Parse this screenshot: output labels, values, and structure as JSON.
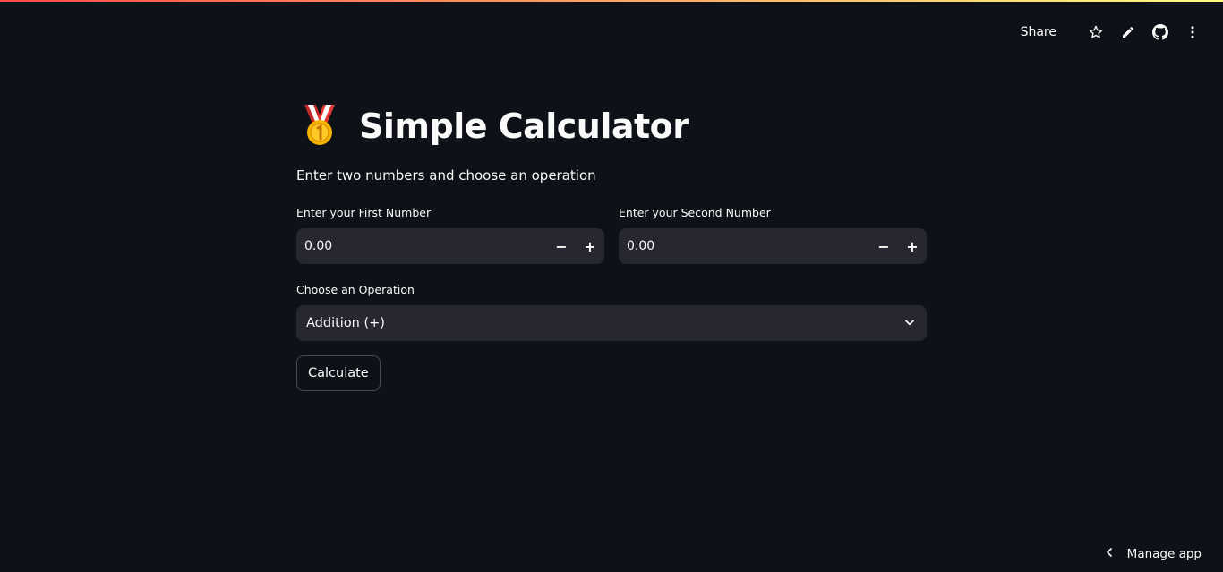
{
  "toolbar": {
    "share_label": "Share",
    "icons": [
      "star-icon",
      "pencil-icon",
      "github-icon",
      "kebab-menu-icon"
    ]
  },
  "header": {
    "title": "Simple Calculator",
    "subtitle": "Enter two numbers and choose an operation",
    "emoji": "medal-icon"
  },
  "form": {
    "first": {
      "label": "Enter your First Number",
      "value": "0.00",
      "minus": "−",
      "plus": "+"
    },
    "second": {
      "label": "Enter your Second Number",
      "value": "0.00",
      "minus": "−",
      "plus": "+"
    },
    "operation": {
      "label": "Choose an Operation",
      "value": "Addition (+)"
    },
    "calculate_label": "Calculate"
  },
  "footer": {
    "manage_label": "Manage app"
  },
  "colors": {
    "background": "#0e1117",
    "input_bg": "#262730",
    "text": "#fafafa",
    "accent_red": "#ff4b4b"
  }
}
